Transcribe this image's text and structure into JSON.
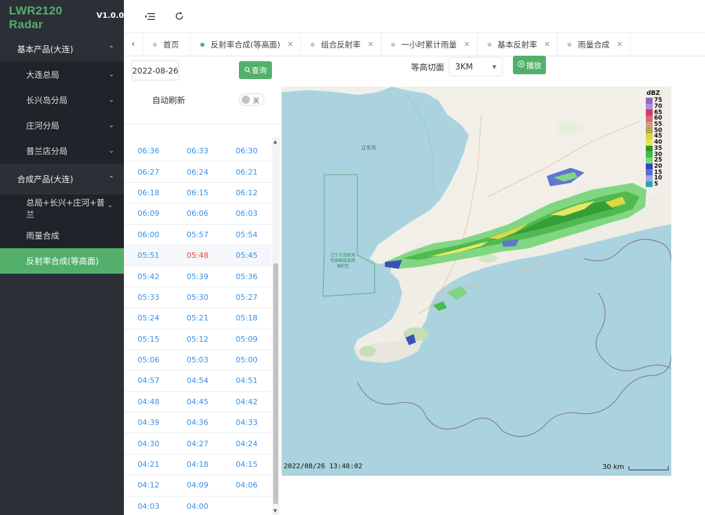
{
  "app": {
    "title": "LWR2120 Radar",
    "version": "V1.0.0"
  },
  "sidebar": {
    "groups": [
      {
        "label": "基本产品(大连)",
        "items": [
          {
            "label": "大连总局"
          },
          {
            "label": "长兴岛分局"
          },
          {
            "label": "庄河分局"
          },
          {
            "label": "普兰店分局"
          }
        ]
      },
      {
        "label": "合成产品(大连)",
        "items": [
          {
            "label": "总局+长兴+庄河+普兰"
          },
          {
            "label": "雨量合成"
          },
          {
            "label": "反射率合成(等高面)"
          }
        ]
      }
    ]
  },
  "tabs": [
    {
      "label": "首页"
    },
    {
      "label": "反射率合成(等高面)"
    },
    {
      "label": "组合反射率"
    },
    {
      "label": "一小时累计雨量"
    },
    {
      "label": "基本反射率"
    },
    {
      "label": "雨量合成"
    }
  ],
  "controls": {
    "date": "2022-08-26",
    "query_label": "查询",
    "auto_refresh_label": "自动刷新",
    "toggle_label": "关",
    "layer_label": "等高切面",
    "layer_value": "3KM",
    "play_label": "播放"
  },
  "times": [
    [
      "06:36",
      "06:33",
      "06:30"
    ],
    [
      "06:27",
      "06:24",
      "06:21"
    ],
    [
      "06:18",
      "06:15",
      "06:12"
    ],
    [
      "06:09",
      "06:06",
      "06:03"
    ],
    [
      "06:00",
      "05:57",
      "05:54"
    ],
    [
      "05:51",
      "05:48",
      "05:45"
    ],
    [
      "05:42",
      "05:39",
      "05:36"
    ],
    [
      "05:33",
      "05:30",
      "05:27"
    ],
    [
      "05:24",
      "05:21",
      "05:18"
    ],
    [
      "05:15",
      "05:12",
      "05:09"
    ],
    [
      "05:06",
      "05:03",
      "05:00"
    ],
    [
      "04:57",
      "04:54",
      "04:51"
    ],
    [
      "04:48",
      "04:45",
      "04:42"
    ],
    [
      "04:39",
      "04:36",
      "04:33"
    ],
    [
      "04:30",
      "04:27",
      "04:24"
    ],
    [
      "04:21",
      "04:18",
      "04:15"
    ],
    [
      "04:12",
      "04:09",
      "04:06"
    ],
    [
      "04:03",
      "04:00",
      ""
    ]
  ],
  "selected_time": "05:48",
  "map": {
    "timestamp": "2022/08/26 13:48:02",
    "scale_label": "30 km",
    "sea_label": "辽东湾",
    "reserve_label": "辽宁大连斑海豹国家级自然保护区",
    "legend_unit": "dBZ",
    "legend": [
      {
        "label": "75",
        "color": "#8c6ec0"
      },
      {
        "label": "70",
        "color": "#b18bd6"
      },
      {
        "label": "65",
        "color": "#d03a6a"
      },
      {
        "label": "60",
        "color": "#e0627e"
      },
      {
        "label": "55",
        "color": "#c8a080"
      },
      {
        "label": "50",
        "color": "#b5a85e"
      },
      {
        "label": "45",
        "color": "#d8d83c"
      },
      {
        "label": "40",
        "color": "#e6e65a"
      },
      {
        "label": "35",
        "color": "#2e9a2e"
      },
      {
        "label": "30",
        "color": "#48b848"
      },
      {
        "label": "25",
        "color": "#7cd67c"
      },
      {
        "label": "20",
        "color": "#3248b8"
      },
      {
        "label": "15",
        "color": "#5a70d0"
      },
      {
        "label": "10",
        "color": "#9aa8e8"
      },
      {
        "label": "5",
        "color": "#2aa6a6"
      }
    ]
  },
  "colors": {
    "accent": "#52b06a",
    "sidebar": "#2b3037",
    "link": "#3a8ee6",
    "selected": "#e04a3a"
  }
}
